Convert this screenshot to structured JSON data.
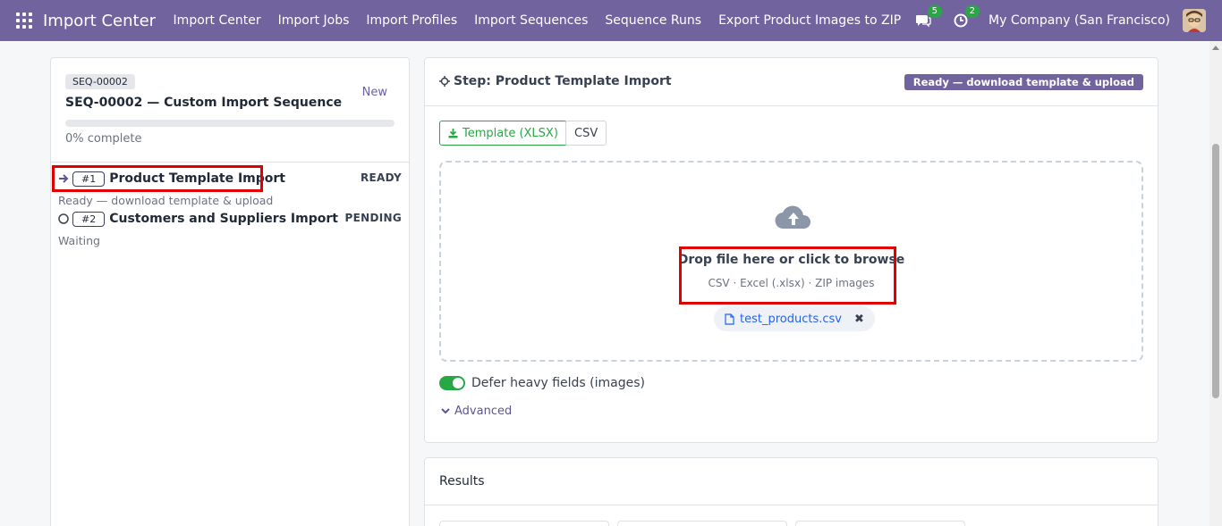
{
  "navbar": {
    "brand": "Import Center",
    "menu": [
      "Import Center",
      "Import Jobs",
      "Import Profiles",
      "Import Sequences",
      "Sequence Runs",
      "Export Product Images to ZIP"
    ],
    "messages_count": "5",
    "activities_count": "2",
    "company": "My Company (San Francisco)"
  },
  "sequence": {
    "tag": "SEQ-00002",
    "title": "SEQ-00002 — Custom Import Sequence",
    "status": "New",
    "progress_fraction": 0,
    "progress_text": "0% complete"
  },
  "steps": [
    {
      "num": "#1",
      "name": "Product Template Import",
      "state": "READY",
      "sub": "Ready — download template & upload"
    },
    {
      "num": "#2",
      "name": "Customers and Suppliers Import",
      "state": "PENDING",
      "sub": "Waiting"
    }
  ],
  "step_panel": {
    "title": "Step: Product Template Import",
    "status_pill": "Ready — download template & upload",
    "template_button": "Template (XLSX)",
    "csv_button": "CSV",
    "drop_title": "Drop file here or click to browse",
    "drop_sub": "CSV · Excel (.xlsx) · ZIP images",
    "file_name": "test_products.csv",
    "toggle_label": "Defer heavy fields (images)",
    "toggle_on": true,
    "advanced_label": "Advanced"
  },
  "results": {
    "title": "Results"
  },
  "colors": {
    "primary": "#71639e",
    "success": "#28a745",
    "highlight": "#e00000"
  }
}
